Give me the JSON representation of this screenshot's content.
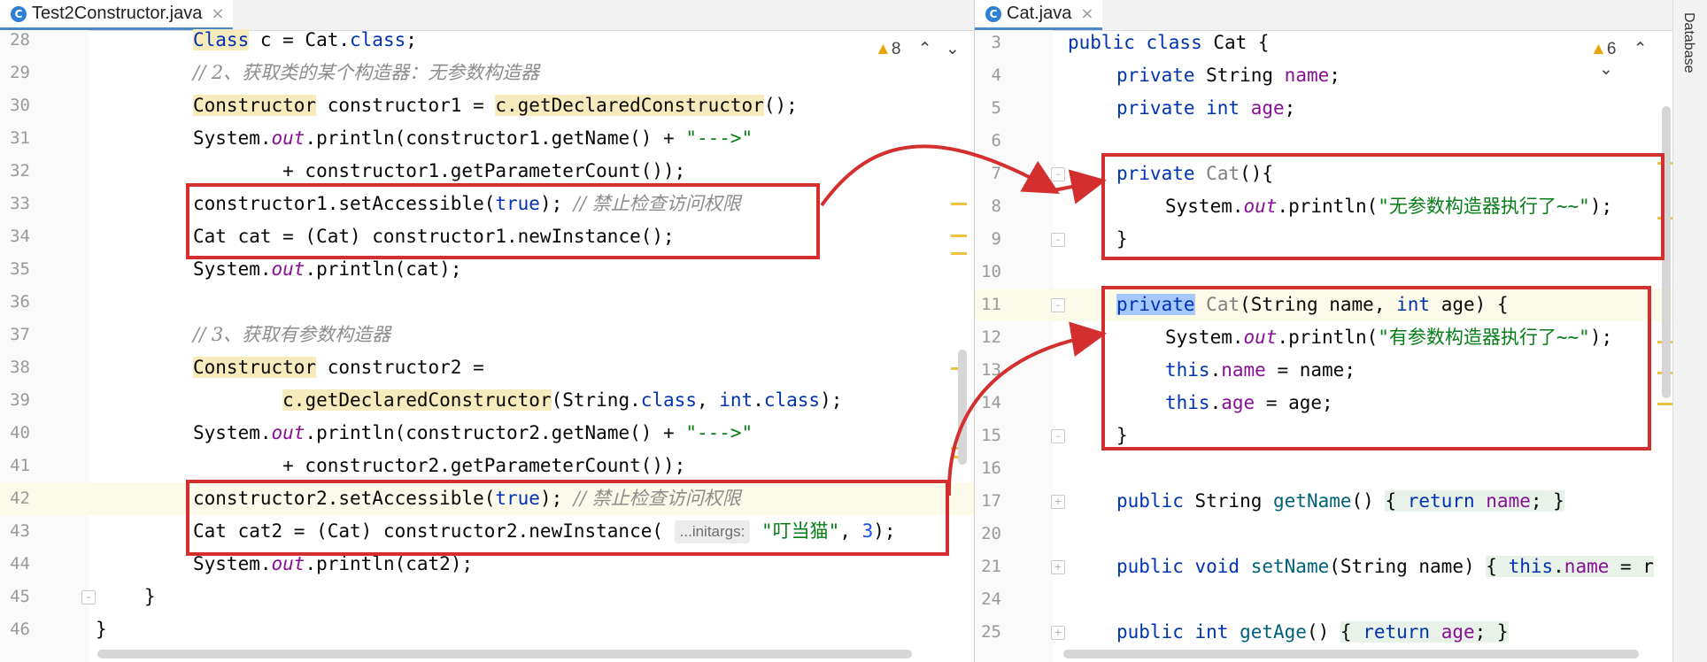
{
  "left_tab": {
    "label": "Test2Constructor.java",
    "close": "×",
    "icon": "C"
  },
  "right_tab": {
    "label": "Cat.java",
    "close": "×",
    "icon": "C"
  },
  "left_warnings": {
    "count": "8"
  },
  "right_warnings": {
    "count": "6"
  },
  "side_tool": {
    "label": "Database"
  },
  "left_lines": [
    {
      "n": "28"
    },
    {
      "n": "29"
    },
    {
      "n": "30"
    },
    {
      "n": "31"
    },
    {
      "n": "32"
    },
    {
      "n": "33"
    },
    {
      "n": "34"
    },
    {
      "n": "35"
    },
    {
      "n": "36"
    },
    {
      "n": "37"
    },
    {
      "n": "38"
    },
    {
      "n": "39"
    },
    {
      "n": "40"
    },
    {
      "n": "41"
    },
    {
      "n": "42"
    },
    {
      "n": "43"
    },
    {
      "n": "44"
    },
    {
      "n": "45"
    },
    {
      "n": "46"
    }
  ],
  "right_lines": [
    {
      "n": "3"
    },
    {
      "n": "4"
    },
    {
      "n": "5"
    },
    {
      "n": "6"
    },
    {
      "n": "7"
    },
    {
      "n": "8"
    },
    {
      "n": "9"
    },
    {
      "n": "10"
    },
    {
      "n": "11"
    },
    {
      "n": "12"
    },
    {
      "n": "13"
    },
    {
      "n": "14"
    },
    {
      "n": "15"
    },
    {
      "n": "16"
    },
    {
      "n": "17"
    },
    {
      "n": "20"
    },
    {
      "n": "21"
    },
    {
      "n": "24"
    },
    {
      "n": "25"
    }
  ],
  "left_code": {
    "l28": {
      "kw": "Class",
      "rest": " c = Cat.",
      "kw2": "class",
      "end": ";"
    },
    "l29": {
      "comment": "// 2、获取类的某个构造器：无参数构造器"
    },
    "l30": {
      "type": "Constructor",
      "mid": " constructor1 = ",
      "call": "c.getDeclaredConstructor",
      "end": "();"
    },
    "l31": {
      "a": "System.",
      "b": "out",
      "c": ".println(constructor1.getName() + ",
      "d": "\"--->\""
    },
    "l32": {
      "a": "        + constructor1.getParameterCount());"
    },
    "l33": {
      "a": "constructor1.setAccessible(",
      "b": "true",
      "c": "); ",
      "d": "// 禁止检查访问权限"
    },
    "l34": {
      "a": "Cat cat = (Cat) constructor1.newInstance();"
    },
    "l35": {
      "a": "System.",
      "b": "out",
      "c": ".println(cat);"
    },
    "l37": {
      "comment": "// 3、获取有参数构造器"
    },
    "l38": {
      "type": "Constructor",
      "mid": " constructor2 ="
    },
    "l39": {
      "pad": "        ",
      "call": "c.getDeclaredConstructor",
      "a": "(String.",
      "b": "class",
      "c": ", ",
      "d": "int",
      "e": ".",
      "f": "class",
      "g": ");"
    },
    "l40": {
      "a": "System.",
      "b": "out",
      "c": ".println(constructor2.getName() + ",
      "d": "\"--->\""
    },
    "l41": {
      "a": "        + constructor2.getParameterCount());"
    },
    "l42": {
      "a": "constructor2.setAccessible(",
      "b": "true",
      "c": "); ",
      "d": "// 禁止检查访问权限"
    },
    "l43": {
      "a": "Cat cat2 = (Cat) constructor2.newInstance( ",
      "hint": "...initargs:",
      "b": " ",
      "c": "\"叮当猫\"",
      "d": ", ",
      "e": "3",
      "f": ");"
    },
    "l44": {
      "a": "System.",
      "b": "out",
      "c": ".println(cat2);"
    },
    "l45": {
      "a": "}"
    },
    "l46": {
      "a": "}"
    }
  },
  "right_code": {
    "l3": {
      "a": "public class",
      "b": " Cat {"
    },
    "l4": {
      "a": "private",
      "b": " String ",
      "c": "name",
      "d": ";"
    },
    "l5": {
      "a": "private int",
      "b": " ",
      "c": "age",
      "d": ";"
    },
    "l7": {
      "a": "private",
      "b": " ",
      "c": "Cat",
      "d": "(){"
    },
    "l8": {
      "a": "System.",
      "b": "out",
      "c": ".println(",
      "d": "\"无参数构造器执行了~~\"",
      "e": ");"
    },
    "l9": {
      "a": "}"
    },
    "l11": {
      "a": "private",
      "b": " ",
      "c": "Cat",
      "d": "(String name, ",
      "e": "int",
      "f": " age) {"
    },
    "l12": {
      "a": "System.",
      "b": "out",
      "c": ".println(",
      "d": "\"有参数构造器执行了~~\"",
      "e": ");"
    },
    "l13": {
      "a": "this",
      "b": ".",
      "c": "name",
      "d": " = name;"
    },
    "l14": {
      "a": "this",
      "b": ".",
      "c": "age",
      "d": " = age;"
    },
    "l15": {
      "a": "}"
    },
    "l17": {
      "a": "public",
      "b": " String ",
      "c": "getName",
      "d": "() ",
      "e": "{ ",
      "f": "return",
      "g": " ",
      "h": "name",
      "i": "; }"
    },
    "l21": {
      "a": "public void",
      "b": " ",
      "c": "setName",
      "d": "(String name) ",
      "e": "{ ",
      "f": "this",
      "g": ".",
      "h": "name",
      "i": " = r"
    },
    "l25": {
      "a": "public int",
      "b": " ",
      "c": "getAge",
      "d": "() ",
      "e": "{ ",
      "f": "return",
      "g": " ",
      "h": "age",
      "i": "; }"
    }
  },
  "colors": {
    "highlight_box": "#d32f2f",
    "keyword": "#0033b3",
    "field": "#871094",
    "string": "#067d17",
    "comment": "#8c8c8c"
  }
}
